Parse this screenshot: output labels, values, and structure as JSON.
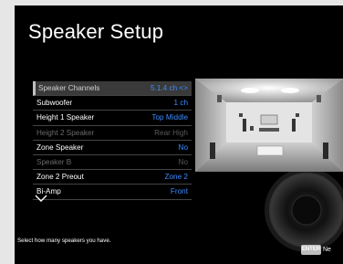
{
  "title": "Speaker Setup",
  "menu": [
    {
      "label": "Speaker Channels",
      "value": "5.1.4 ch <>",
      "state": "selected"
    },
    {
      "label": "Subwoofer",
      "value": "1 ch",
      "state": "normal"
    },
    {
      "label": "Height 1 Speaker",
      "value": "Top Middle",
      "state": "normal"
    },
    {
      "label": "Height 2 Speaker",
      "value": "Rear High",
      "state": "dim"
    },
    {
      "label": "Zone Speaker",
      "value": "No",
      "state": "normal"
    },
    {
      "label": "Speaker B",
      "value": "No",
      "state": "dim"
    },
    {
      "label": "Zone 2 Preout",
      "value": "Zone 2",
      "state": "normal"
    },
    {
      "label": "Bi-Amp",
      "value": "Front",
      "state": "normal"
    }
  ],
  "hint": "Select how many speakers you have.",
  "footer": {
    "enter_label": "ENTER",
    "next_label": "Ne"
  },
  "colors": {
    "value_blue": "#3b8cff",
    "selected_bg": "#3a3a3a"
  },
  "icons": {
    "scroll_down": "chevron-down-icon"
  }
}
